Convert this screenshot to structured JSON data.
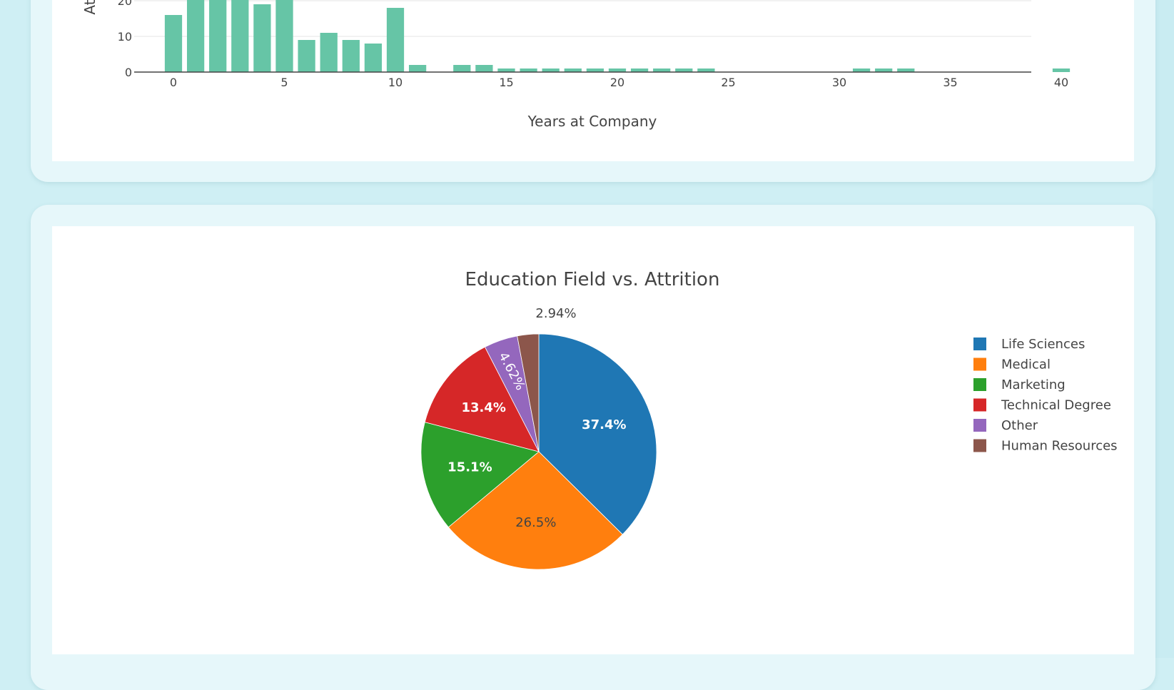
{
  "charts_panel": {
    "colors": {
      "page_bg": "#cfeff4",
      "card_bg": "#e6f7fa",
      "bar_color": "#66c5a6",
      "text": "#444444"
    }
  },
  "chart_data": [
    {
      "type": "bar",
      "title": "",
      "xlabel": "Years at Company",
      "ylabel": "At",
      "xlim": [
        -0.5,
        40.5
      ],
      "ylim": [
        0,
        20
      ],
      "x_ticks": [
        "0",
        "5",
        "10",
        "15",
        "20",
        "25",
        "30",
        "35",
        "40"
      ],
      "y_ticks": [
        "0",
        "10",
        "20"
      ],
      "grid": true,
      "series": [
        {
          "x": [
            0,
            1,
            2,
            3,
            4,
            5,
            6,
            7,
            8,
            9,
            10,
            11,
            13,
            14,
            15,
            16,
            17,
            18,
            19,
            20,
            21,
            22,
            23,
            24,
            31,
            32,
            33,
            40
          ],
          "values": [
            16,
            27,
            27,
            27,
            19,
            21,
            9,
            11,
            9,
            8,
            18,
            2,
            2,
            2,
            1,
            1,
            1,
            1,
            1,
            1,
            1,
            1,
            1,
            1,
            1,
            1,
            1,
            1
          ]
        }
      ]
    },
    {
      "type": "pie",
      "title": "Education Field vs. Attrition",
      "legend_placement": "right",
      "slices": [
        {
          "label": "Life Sciences",
          "value": 37.4,
          "text": "37.4%",
          "color": "#1f77b4"
        },
        {
          "label": "Medical",
          "value": 26.5,
          "text": "26.5%",
          "color": "#ff7f0e"
        },
        {
          "label": "Marketing",
          "value": 15.1,
          "text": "15.1%",
          "color": "#2ca02c"
        },
        {
          "label": "Technical Degree",
          "value": 13.4,
          "text": "13.4%",
          "color": "#d62728"
        },
        {
          "label": "Other",
          "value": 4.62,
          "text": "4.62%",
          "color": "#9467bd"
        },
        {
          "label": "Human Resources",
          "value": 2.94,
          "text": "2.94%",
          "color": "#8c564b"
        }
      ]
    }
  ]
}
